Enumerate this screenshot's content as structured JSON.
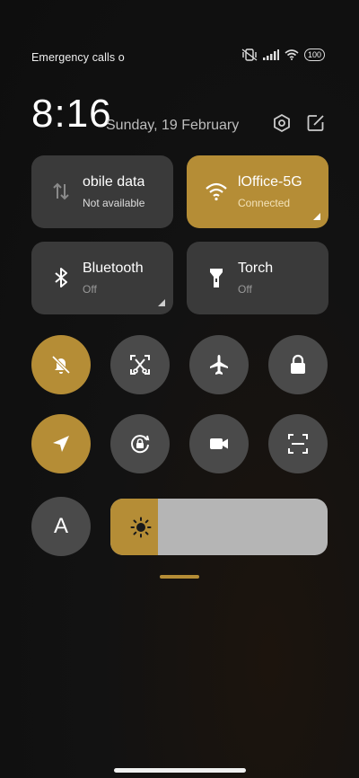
{
  "status_bar": {
    "carrier_text": "Emergency calls o",
    "battery_level": "100"
  },
  "header": {
    "time": "8:16",
    "date": "Sunday, 19 February"
  },
  "tiles": [
    {
      "title": "obile data",
      "subtitle": "Not available",
      "active": false
    },
    {
      "title": "lOffice-5G",
      "subtitle": "Connected",
      "active": true
    },
    {
      "title": "Bluetooth",
      "subtitle": "Off",
      "active": false
    },
    {
      "title": "Torch",
      "subtitle": "Off",
      "active": false
    }
  ],
  "toggles": [
    {
      "icon": "bell-off-icon",
      "active": true
    },
    {
      "icon": "screenshot-icon",
      "active": false
    },
    {
      "icon": "airplane-icon",
      "active": false
    },
    {
      "icon": "lock-icon",
      "active": false
    },
    {
      "icon": "location-icon",
      "active": true
    },
    {
      "icon": "rotation-lock-icon",
      "active": false
    },
    {
      "icon": "video-camera-icon",
      "active": false
    },
    {
      "icon": "scanner-icon",
      "active": false
    }
  ],
  "auto_brightness_label": "A",
  "brightness": {
    "level": 0.22
  },
  "colors": {
    "accent": "#b58d36",
    "tile": "#3a3a3a",
    "round": "#4a4a4a"
  }
}
